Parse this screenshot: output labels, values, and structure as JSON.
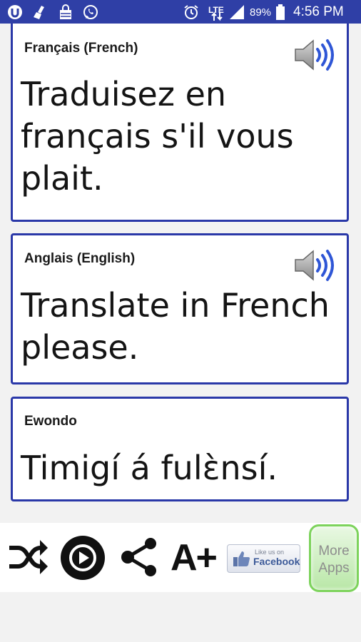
{
  "status_bar": {
    "icons_left": [
      "vpn-icon",
      "clean-icon",
      "shopping-bag-icon",
      "whatsapp-icon"
    ],
    "alarm_icon": "alarm-clock-icon",
    "network": "LTE",
    "battery": "89%",
    "time": "4:56 PM"
  },
  "cards": [
    {
      "language": "Français (French)",
      "text": "Traduisez en français s'il vous plait.",
      "has_speaker": true
    },
    {
      "language": "Anglais (English)",
      "text": "Translate in French please.",
      "has_speaker": true
    },
    {
      "language": "Ewondo",
      "text": "Timigí á fulɛ̀nsí.",
      "has_speaker": false
    }
  ],
  "toolbar": {
    "shuffle_icon": "shuffle-icon",
    "play_icon": "play-icon",
    "share_icon": "share-icon",
    "font_size_label": "A+",
    "facebook_like_text": "Like us on",
    "facebook_label": "Facebook",
    "more_apps_line1": "More",
    "more_apps_line2": "Apps"
  },
  "colors": {
    "status_bar": "#2f3fa6",
    "card_border": "#2a38a8",
    "speaker_waves": "#2f56d6",
    "more_apps_border": "#7dd35c"
  }
}
